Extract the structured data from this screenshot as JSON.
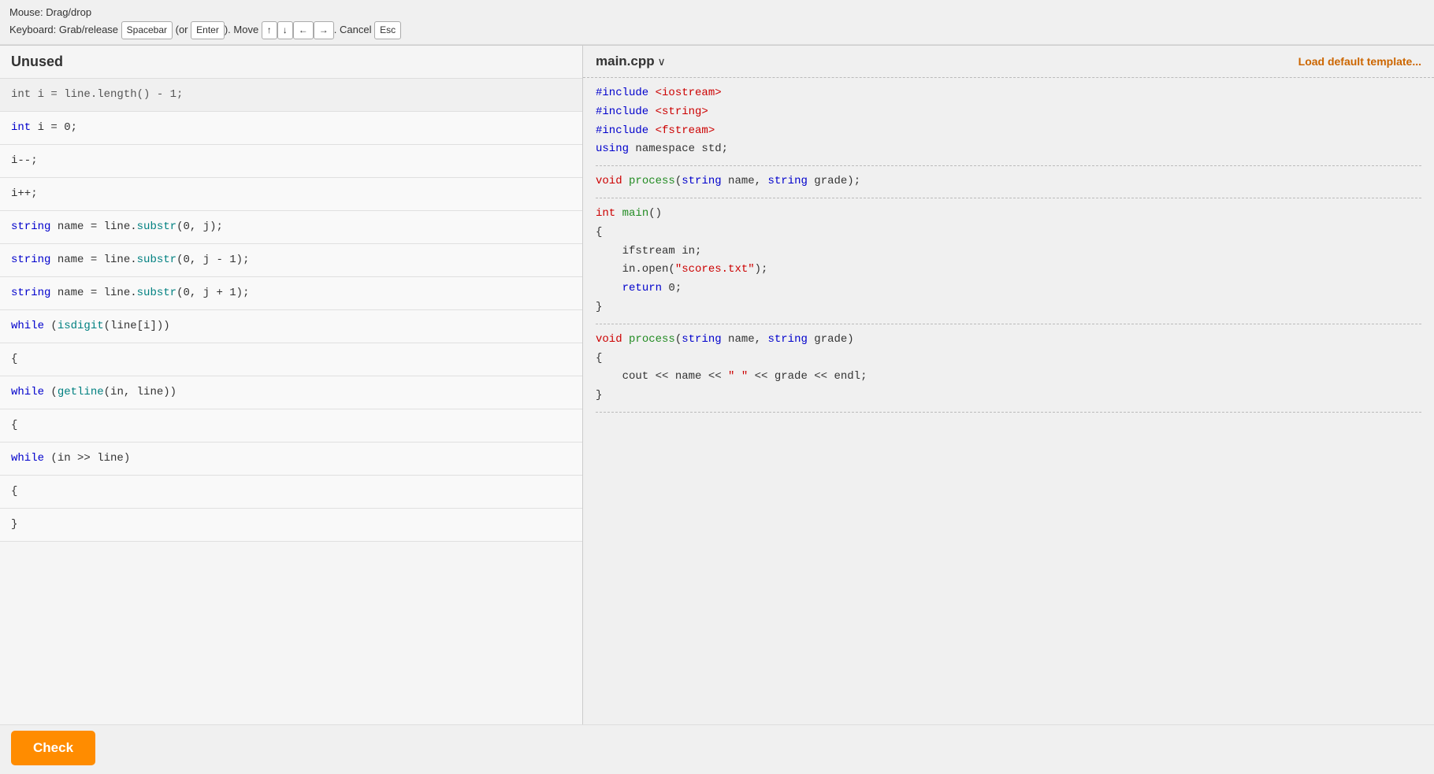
{
  "instructions": {
    "line1": "Mouse: Drag/drop",
    "line2_prefix": "Keyboard: Grab/release ",
    "spacebar": "Spacebar",
    "or": " (or ",
    "enter": "Enter",
    "close_paren": "). Move ",
    "up": "↑",
    "down": "↓",
    "left": "←",
    "right": "→",
    "cancel": ". Cancel ",
    "esc": "Esc"
  },
  "left_panel": {
    "title": "Unused",
    "items": [
      {
        "id": "item0",
        "text": "int i = line.length() - 1;",
        "type": "partial"
      },
      {
        "id": "item1",
        "text": "int i = 0;",
        "type": "normal"
      },
      {
        "id": "item2",
        "text": "i--;",
        "type": "normal"
      },
      {
        "id": "item3",
        "text": "i++;",
        "type": "normal"
      },
      {
        "id": "item4",
        "text": "string name = line.substr(0, j);",
        "type": "normal"
      },
      {
        "id": "item5",
        "text": "string name = line.substr(0, j - 1);",
        "type": "normal"
      },
      {
        "id": "item6",
        "text": "string name = line.substr(0, j + 1);",
        "type": "normal"
      },
      {
        "id": "item7a",
        "text": "while (isdigit(line[i]))",
        "type": "while"
      },
      {
        "id": "item7b",
        "text": "{",
        "type": "brace"
      },
      {
        "id": "item8a",
        "text": "while (getline(in, line))",
        "type": "while"
      },
      {
        "id": "item8b",
        "text": "{",
        "type": "brace"
      },
      {
        "id": "item9a",
        "text": "while (in >> line)",
        "type": "while"
      },
      {
        "id": "item9b",
        "text": "{",
        "type": "brace"
      },
      {
        "id": "item9c",
        "text": "}",
        "type": "brace"
      }
    ]
  },
  "right_panel": {
    "file_title": "main.cpp",
    "chevron": "∨",
    "load_default": "Load default template...",
    "code_sections": [
      {
        "id": "includes",
        "lines": [
          "#include <iostream>",
          "#include <string>",
          "#include <fstream>",
          "using namespace std;"
        ]
      },
      {
        "id": "declaration",
        "lines": [
          "void process(string name, string grade);"
        ]
      },
      {
        "id": "main_func",
        "lines": [
          "int main()",
          "{",
          "    ifstream in;",
          "    in.open(\"scores.txt\");",
          "",
          "    return 0;",
          "}"
        ]
      },
      {
        "id": "process_func",
        "lines": [
          "void process(string name, string grade)",
          "{",
          "    cout << name << \" \" << grade << endl;",
          "}"
        ]
      }
    ]
  },
  "bottom_bar": {
    "check_label": "Check"
  }
}
